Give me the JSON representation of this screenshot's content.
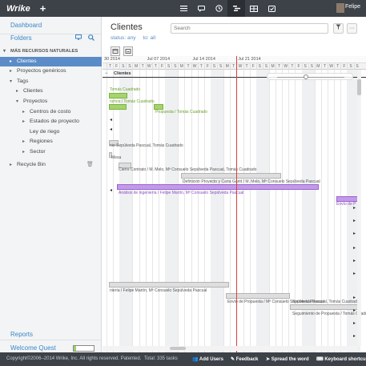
{
  "topbar": {
    "logo": "Wrike",
    "plus": "+",
    "user_name": "Felipe"
  },
  "sidebar": {
    "dashboard": "Dashboard",
    "folders": "Folders",
    "tree": [
      {
        "label": "MÁS RECURSOS NATURALES",
        "indent": 0,
        "arrow": "▾",
        "head": true
      },
      {
        "label": "Clientes",
        "indent": 1,
        "arrow": "▸",
        "selected": true
      },
      {
        "label": "Proyectos genéricos",
        "indent": 1,
        "arrow": "▸"
      },
      {
        "label": "Tags",
        "indent": 1,
        "arrow": "▾"
      },
      {
        "label": "Clientes",
        "indent": 2,
        "arrow": "▸"
      },
      {
        "label": "Proyectos",
        "indent": 2,
        "arrow": "▾"
      },
      {
        "label": "Centros de costo",
        "indent": 3,
        "arrow": "▸"
      },
      {
        "label": "Estados de proyecto",
        "indent": 3,
        "arrow": "▸"
      },
      {
        "label": "Ley de riego",
        "indent": 3,
        "arrow": ""
      },
      {
        "label": "Regiones",
        "indent": 3,
        "arrow": "▸"
      },
      {
        "label": "Sector",
        "indent": 3,
        "arrow": "▸"
      },
      {
        "label": "Recycle Bin",
        "indent": 1,
        "arrow": "▸"
      }
    ],
    "reports": "Reports",
    "welcome_quest": "Welcome Quest",
    "welcome_progress": 0.12
  },
  "main": {
    "title": "Clientes",
    "status_label": "status:",
    "status_value": "any",
    "to_label": "to:",
    "to_value": "all",
    "search_placeholder": "Search",
    "more": "···"
  },
  "gantt": {
    "weeks": [
      "30 2014",
      "Jul 07 2014",
      "Jul 14 2014",
      "Jul 21 2014"
    ],
    "days": [
      "T",
      "F",
      "S",
      "S",
      "M",
      "T",
      "W",
      "T",
      "F",
      "S",
      "S",
      "M",
      "T",
      "W",
      "T",
      "F",
      "S",
      "S",
      "M",
      "T",
      "W",
      "T",
      "F",
      "S",
      "S",
      "M",
      "T",
      "W",
      "T",
      "F",
      "S",
      "S",
      "M",
      "T",
      "W",
      "T",
      "F",
      "S",
      "S"
    ],
    "group_label": "Clientes",
    "labels": [
      "Tomás Cuadrado",
      "nchos / Tomás Cuadrado",
      "Propuesta / Tomás Cuadrado",
      "nio Sepúlveda Pascual, Tomás Cuadrado",
      "Mesa",
      "Cierre Contrato / M. Melo, Mª Consuelo Sepúlveda Pascual, Tomás Cuadrado",
      "Definición Proyecto y Carta Gantt / M. Melo, Mª Consuelo Sepúlveda Pascual",
      "Análisis de ingeniería / Felipe Martín, Mª Consuelo Sepúlveda Pascual",
      "Envío de P",
      "niería / Felipe Martín, Mª Consuelo Sepúlveda Pascual",
      "Envío de Propuesta / Mª Consuelo Sepúlveda Pascual",
      "Sepúlveda Pascual, Tomás Cuadrado",
      "Seguimiento de Propuesta / Tomás Cuadrado"
    ]
  },
  "footer": {
    "copyright": "Copyright©2006–2014 Wrike, Inc. All rights reserved. Patented.",
    "total": "Total: 335 tasks",
    "add_users": "Add Users",
    "feedback": "Feedback",
    "spread": "Spread the word",
    "shortcuts": "Keyboard shortcu"
  }
}
